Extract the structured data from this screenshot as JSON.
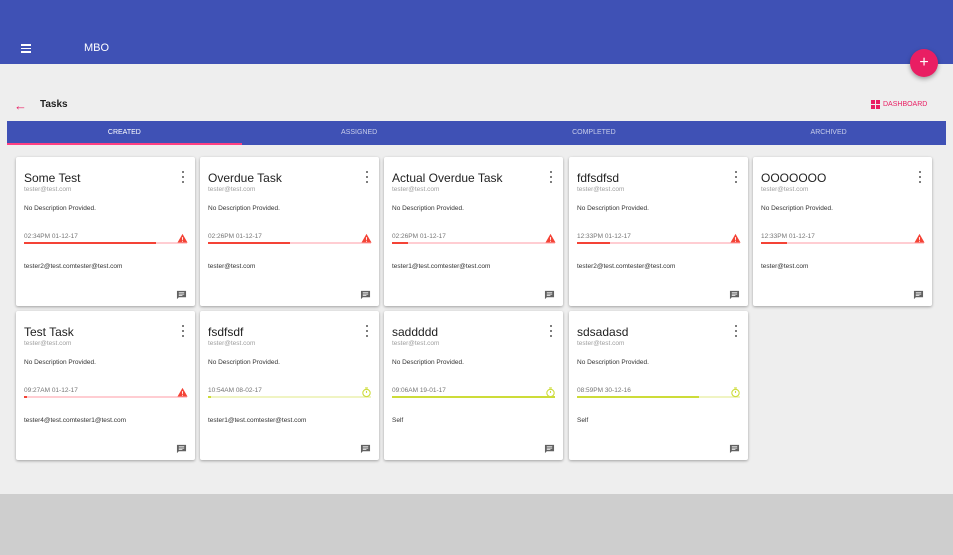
{
  "app": {
    "title": "MBO",
    "fab_label": "+"
  },
  "header": {
    "back_icon": "arrow-back-icon",
    "title": "Tasks",
    "dashboard_label": "DASHBOARD"
  },
  "tabs": [
    {
      "label": "CREATED",
      "active": true
    },
    {
      "label": "ASSIGNED",
      "active": false
    },
    {
      "label": "COMPLETED",
      "active": false
    },
    {
      "label": "ARCHIVED",
      "active": false
    }
  ],
  "colors": {
    "primary": "#3f51b5",
    "accent": "#e91e63",
    "overdue": "#f44336",
    "overdue_track": "#ffcdd2",
    "pending": "#cddc39",
    "pending_track": "#f0f4c3"
  },
  "tasks": [
    {
      "title": "Some Test",
      "owner": "tester@test.com",
      "description": "No Description Provided.",
      "due": "02:34PM 01-12-17",
      "progress": 0.81,
      "status": "overdue",
      "assignees": "tester2@test.comtester@test.com"
    },
    {
      "title": "Overdue Task",
      "owner": "tester@test.com",
      "description": "No Description Provided.",
      "due": "02:26PM 01-12-17",
      "progress": 0.5,
      "status": "overdue",
      "assignees": "tester@test.com"
    },
    {
      "title": "Actual Overdue Task",
      "owner": "tester@test.com",
      "description": "No Description Provided.",
      "due": "02:26PM 01-12-17",
      "progress": 0.1,
      "status": "overdue",
      "assignees": "tester1@test.comtester@test.com"
    },
    {
      "title": "fdfsdfsd",
      "owner": "tester@test.com",
      "description": "No Description Provided.",
      "due": "12:33PM 01-12-17",
      "progress": 0.2,
      "status": "overdue",
      "assignees": "tester2@test.comtester@test.com"
    },
    {
      "title": "OOOOOOO",
      "owner": "tester@test.com",
      "description": "No Description Provided.",
      "due": "12:33PM 01-12-17",
      "progress": 0.16,
      "status": "overdue",
      "assignees": "tester@test.com"
    },
    {
      "title": "Test Task",
      "owner": "tester@test.com",
      "description": "No Description Provided.",
      "due": "09:27AM 01-12-17",
      "progress": 0.02,
      "status": "overdue",
      "assignees": "tester4@test.comtester1@test.com"
    },
    {
      "title": "fsdfsdf",
      "owner": "tester@test.com",
      "description": "No Description Provided.",
      "due": "10:54AM 08-02-17",
      "progress": 0.02,
      "status": "pending",
      "assignees": "tester1@test.comtester@test.com"
    },
    {
      "title": "saddddd",
      "owner": "tester@test.com",
      "description": "No Description Provided.",
      "due": "09:06AM 19-01-17",
      "progress": 1.0,
      "status": "pending",
      "assignees": "Self"
    },
    {
      "title": "sdsadasd",
      "owner": "tester@test.com",
      "description": "No Description Provided.",
      "due": "08:59PM 30-12-16",
      "progress": 0.75,
      "status": "pending",
      "assignees": "Self"
    }
  ]
}
